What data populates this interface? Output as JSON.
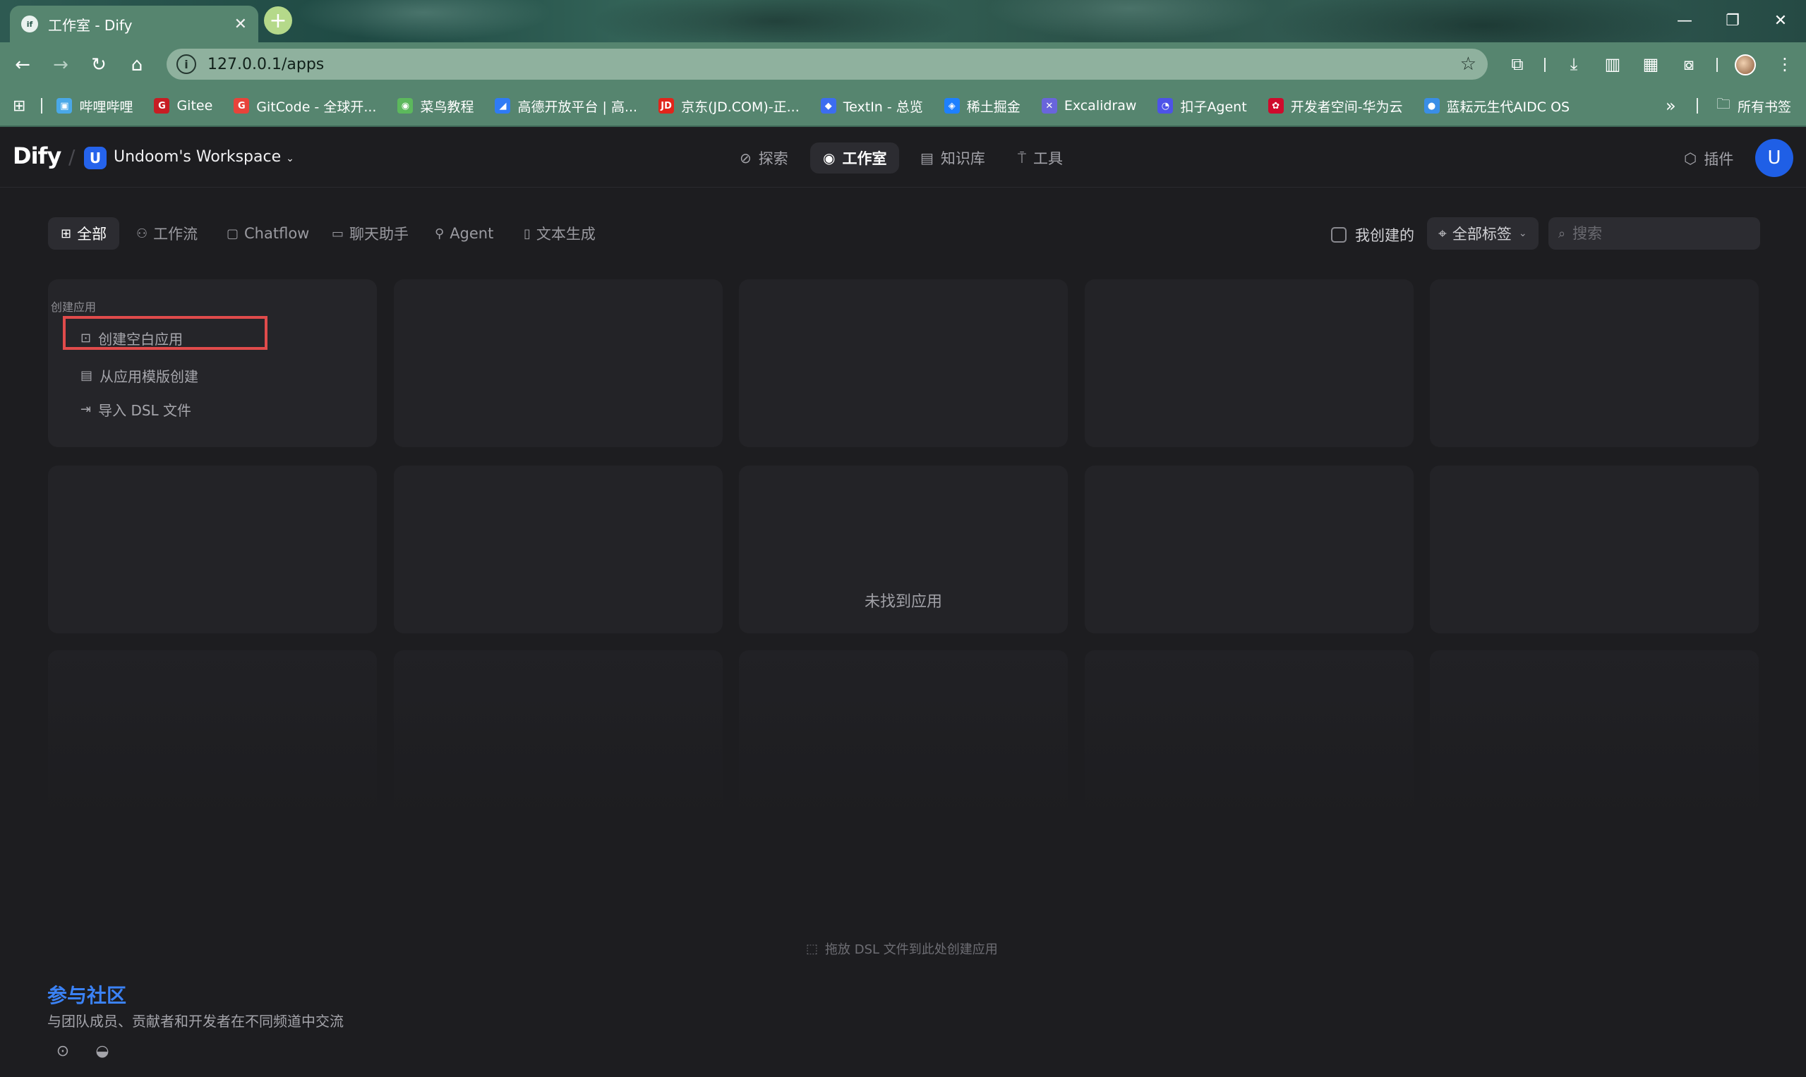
{
  "browser": {
    "tab_title": "工作室 - Dify",
    "tab_favicon": "if",
    "new_tab": "+",
    "url": "127.0.0.1/apps",
    "bookmarks": [
      {
        "label": "哔哩哔哩",
        "color": "#4aa8e8",
        "glyph": "▣"
      },
      {
        "label": "Gitee",
        "color": "#c71d23",
        "glyph": "G"
      },
      {
        "label": "GitCode - 全球开...",
        "color": "#e8433a",
        "glyph": "G"
      },
      {
        "label": "菜鸟教程",
        "color": "#5cb85c",
        "glyph": "◉"
      },
      {
        "label": "高德开放平台 | 高...",
        "color": "#2f7bf5",
        "glyph": "◢"
      },
      {
        "label": "京东(JD.COM)-正...",
        "color": "#e1251b",
        "glyph": "JD"
      },
      {
        "label": "TextIn - 总览",
        "color": "#3c6df0",
        "glyph": "◆"
      },
      {
        "label": "稀土掘金",
        "color": "#1e80ff",
        "glyph": "◈"
      },
      {
        "label": "Excalidraw",
        "color": "#6965db",
        "glyph": "✕"
      },
      {
        "label": "扣子Agent",
        "color": "#4d53e8",
        "glyph": "◔"
      },
      {
        "label": "开发者空间-华为云",
        "color": "#cf0a2c",
        "glyph": "✿"
      },
      {
        "label": "蓝耘元生代AIDC OS",
        "color": "#3a8ee6",
        "glyph": "●"
      }
    ],
    "more": "»",
    "all_bookmarks": "所有书签"
  },
  "header": {
    "logo": "Dify",
    "workspace_initial": "U",
    "workspace_name": "Undoom's Workspace",
    "nav": [
      {
        "label": "探索",
        "icon": "⊘"
      },
      {
        "label": "工作室",
        "icon": "◉"
      },
      {
        "label": "知识库",
        "icon": "▤"
      },
      {
        "label": "工具",
        "icon": "⍑"
      }
    ],
    "plugin_label": "插件",
    "user_initial": "U"
  },
  "filters": {
    "tabs": [
      {
        "label": "全部",
        "icon": "⊞"
      },
      {
        "label": "工作流",
        "icon": "⚇"
      },
      {
        "label": "Chatflow",
        "icon": "▢"
      },
      {
        "label": "聊天助手",
        "icon": "▭"
      },
      {
        "label": "Agent",
        "icon": "⚲"
      },
      {
        "label": "文本生成",
        "icon": "▯"
      }
    ],
    "mine_label": "我创建的",
    "tags_label": "全部标签",
    "search_placeholder": "搜索"
  },
  "create_card": {
    "title": "创建应用",
    "items": [
      {
        "label": "创建空白应用",
        "icon": "⊡"
      },
      {
        "label": "从应用模版创建",
        "icon": "▤"
      },
      {
        "label": "导入 DSL 文件",
        "icon": "⇥"
      }
    ]
  },
  "empty_message": "未找到应用",
  "drop_hint": "拖放 DSL 文件到此处创建应用",
  "community": {
    "title": "参与社区",
    "subtitle": "与团队成员、贡献者和开发者在不同频道中交流"
  },
  "colors": {
    "accent": "#2563eb",
    "highlight_box": "#e04b4b",
    "community_link": "#3b82f6"
  }
}
